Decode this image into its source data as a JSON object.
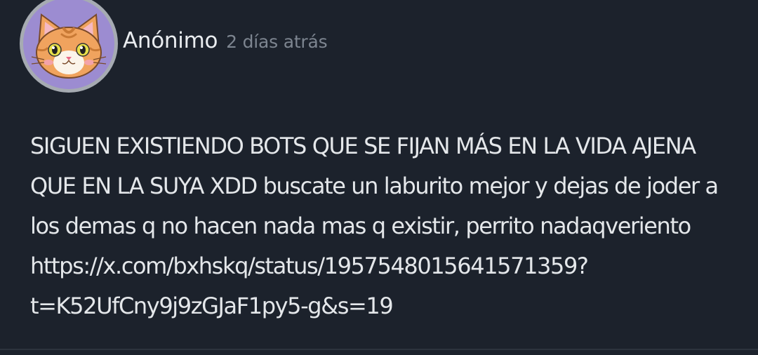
{
  "post": {
    "author": "Anónimo",
    "time": "2 días atrás",
    "avatar_icon": "cat-face-icon",
    "body_lines": [
      "SIGUEN EXISTIENDO BOTS QUE SE FIJAN MÁS EN LA VIDA AJENA",
      "QUE EN LA SUYA XDD buscate un laburito mejor y dejas de joder a",
      "los demas q no hacen nada mas q existir, perrito nadaqveriento",
      "https://x.com/bxhskq/status/1957548015641571359?",
      "t=K52UfCny9j9zGJaF1py5-g&s=19"
    ]
  },
  "colors": {
    "background": "#1c222c",
    "avatar_bg": "#9c8cd1",
    "avatar_ring": "#a6abb2",
    "author_text": "#e9ecef",
    "time_text": "#7d8590",
    "body_text": "#e4e7ea"
  }
}
